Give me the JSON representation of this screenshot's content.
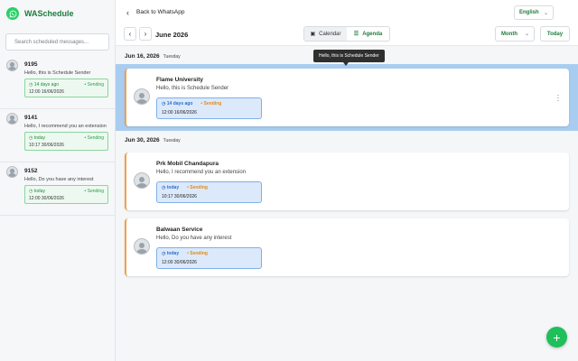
{
  "app": {
    "name": "WASchedule"
  },
  "sidebar": {
    "search_placeholder": "Search scheduled messages...",
    "items": [
      {
        "title": "9195",
        "message": "Hello, this is Schedule Sender",
        "ago": "14 days ago",
        "status": "Sending",
        "datetime": "12:00 16/06/2026"
      },
      {
        "title": "9141",
        "message": "Hello,   I recommend you an extension",
        "ago": "today",
        "status": "Sending",
        "datetime": "10:17 30/06/2026"
      },
      {
        "title": "9152",
        "message": "Hello, Do you have any interest",
        "ago": "today",
        "status": "Sending",
        "datetime": "12:00 30/06/2026"
      }
    ]
  },
  "header": {
    "back_label": "Back to WhatsApp",
    "language": "English"
  },
  "toolbar": {
    "prev_icon": "chevron-left",
    "next_icon": "chevron-right",
    "period": "June 2026",
    "view_calendar": "Calendar",
    "view_agenda": "Agenda",
    "range": "Month",
    "today": "Today"
  },
  "agenda": {
    "groups": [
      {
        "date": "Jun 16, 2026",
        "weekday": "Tuesday",
        "items": [
          {
            "title": "Flame University",
            "message": "Hello, this is Schedule Sender",
            "ago": "14 days ago",
            "status": "Sending",
            "datetime": "12:00 16/06/2026"
          }
        ]
      },
      {
        "date": "Jun 30, 2026",
        "weekday": "Tuesday",
        "items": [
          {
            "title": "Prk Mobil Chandapura",
            "message": "Hello,   I recommend you an extension",
            "ago": "today",
            "status": "Sending",
            "datetime": "10:17 30/06/2026"
          },
          {
            "title": "Balwaan Service",
            "message": "Hello, Do you have any interest",
            "ago": "today",
            "status": "Sending",
            "datetime": "12:00 30/06/2026"
          }
        ]
      }
    ]
  },
  "tooltip": "Hello, this is Schedule Sender",
  "colors": {
    "brand": "#25d366",
    "accent_green": "#1c7c3c",
    "sending": "#e08a1e",
    "highlight": "#a9cdf0"
  }
}
